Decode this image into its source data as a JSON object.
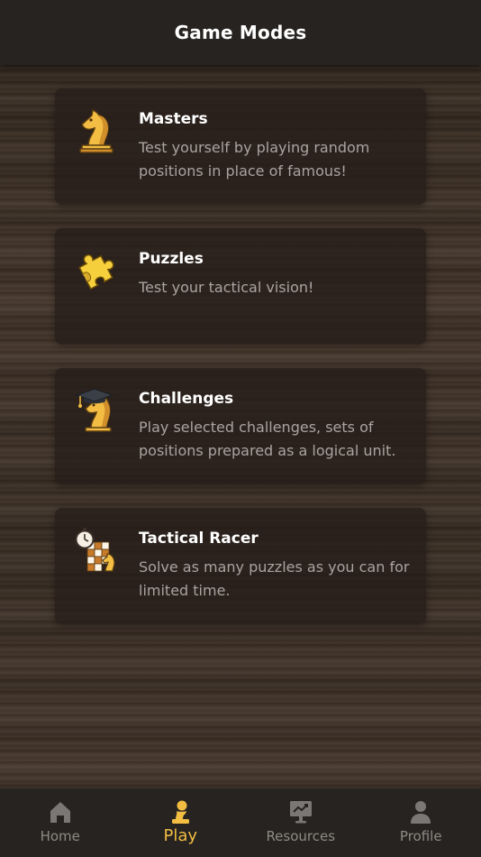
{
  "header": {
    "title": "Game Modes"
  },
  "modes": [
    {
      "title": "Masters",
      "description": "Test yourself by playing random positions in place of famous!",
      "icon": "knight-icon"
    },
    {
      "title": "Puzzles",
      "description": "Test your tactical vision!",
      "icon": "puzzle-piece-icon"
    },
    {
      "title": "Challenges",
      "description": "Play selected challenges, sets of positions prepared as a logical unit.",
      "icon": "graduate-knight-icon"
    },
    {
      "title": "Tactical Racer",
      "description": "Solve as many puzzles as you can for limited time.",
      "icon": "stopwatch-board-icon"
    }
  ],
  "nav": {
    "items": [
      {
        "label": "Home",
        "icon": "home-icon",
        "active": false
      },
      {
        "label": "Play",
        "icon": "pawn-icon",
        "active": true
      },
      {
        "label": "Resources",
        "icon": "chart-monitor-icon",
        "active": false
      },
      {
        "label": "Profile",
        "icon": "user-icon",
        "active": false
      }
    ]
  },
  "colors": {
    "accent": "#f2bd42",
    "header_bg": "#262320",
    "card_bg": "#261e19",
    "inactive": "#8e8a86"
  }
}
